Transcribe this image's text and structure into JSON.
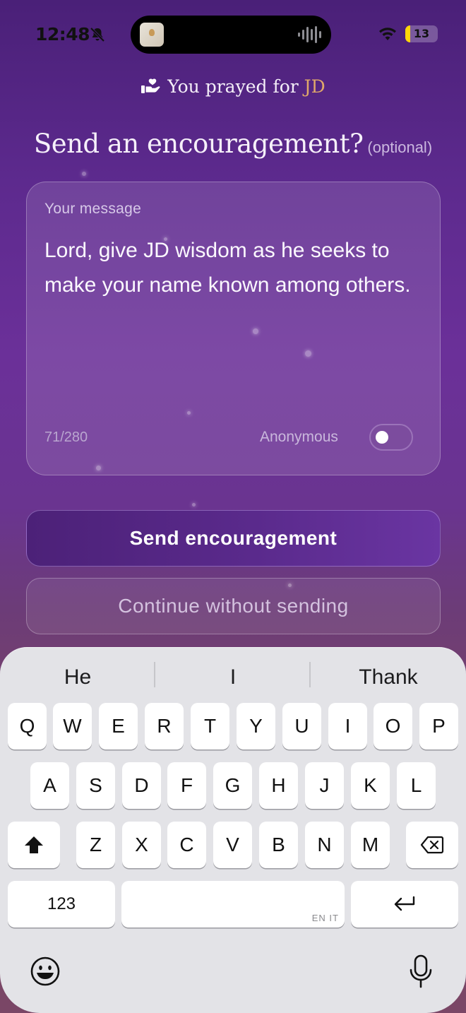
{
  "status_bar": {
    "time": "12:48",
    "battery": "13",
    "battery_color": "#ffd60a"
  },
  "header": {
    "prayed_prefix": "You prayed for ",
    "prayed_name": "JD",
    "name_color": "#e0a86a",
    "icon": "praying-hand-heart-icon"
  },
  "prompt": {
    "title": "Send an encouragement?",
    "optional": "(optional)"
  },
  "message_card": {
    "label": "Your message",
    "text": "Lord, give JD wisdom as he seeks to make your name known among others.",
    "char_count": "71/280",
    "anonymous_label": "Anonymous",
    "anonymous_on": false
  },
  "buttons": {
    "send": "Send encouragement",
    "continue": "Continue without sending"
  },
  "keyboard": {
    "suggestions": [
      "He",
      "I",
      "Thank"
    ],
    "row1": [
      "Q",
      "W",
      "E",
      "R",
      "T",
      "Y",
      "U",
      "I",
      "O",
      "P"
    ],
    "row2": [
      "A",
      "S",
      "D",
      "F",
      "G",
      "H",
      "J",
      "K",
      "L"
    ],
    "row3": [
      "Z",
      "X",
      "C",
      "V",
      "B",
      "N",
      "M"
    ],
    "numbers_key": "123",
    "space_lang": "EN IT",
    "icons": [
      "shift-icon",
      "backspace-icon",
      "return-icon",
      "emoji-icon",
      "microphone-icon"
    ]
  }
}
